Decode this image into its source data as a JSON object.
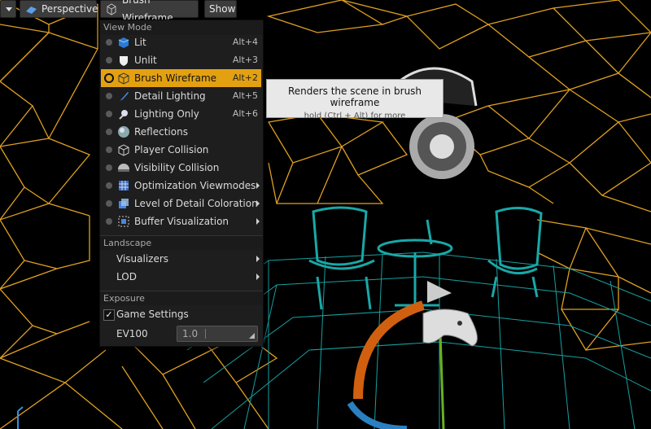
{
  "toolbar": {
    "perspective_label": "Perspective",
    "viewmode_label": "Brush Wireframe",
    "show_label": "Show"
  },
  "menu": {
    "section_viewmode": "View Mode",
    "items": [
      {
        "label": "Lit",
        "shortcut": "Alt+4",
        "icon": "lit-cube-icon"
      },
      {
        "label": "Unlit",
        "shortcut": "Alt+3",
        "icon": "shield-icon"
      },
      {
        "label": "Brush Wireframe",
        "shortcut": "Alt+2",
        "icon": "wireframe-cube-icon"
      },
      {
        "label": "Detail Lighting",
        "shortcut": "Alt+5",
        "icon": "brush-icon"
      },
      {
        "label": "Lighting Only",
        "shortcut": "Alt+6",
        "icon": "bulb-icon"
      },
      {
        "label": "Reflections",
        "icon": "sphere-icon"
      },
      {
        "label": "Player Collision",
        "icon": "outline-cube-icon"
      },
      {
        "label": "Visibility Collision",
        "icon": "half-sphere-icon"
      },
      {
        "label": "Optimization Viewmodes",
        "icon": "grid-icon"
      },
      {
        "label": "Level of Detail Coloration",
        "icon": "stacked-squares-icon"
      },
      {
        "label": "Buffer Visualization",
        "icon": "dotted-square-icon"
      }
    ],
    "section_landscape": "Landscape",
    "landscape_items": [
      {
        "label": "Visualizers"
      },
      {
        "label": "LOD"
      }
    ],
    "section_exposure": "Exposure",
    "game_settings_label": "Game Settings",
    "game_settings_checked": true,
    "ev100_label": "EV100",
    "ev100_value": "1.0"
  },
  "tooltip": {
    "title": "Renders the scene in brush wireframe",
    "hint": "hold (Ctrl + Alt) for more"
  },
  "colors": {
    "accent": "#e3a112",
    "wire_orange": "#e0a020",
    "wire_teal": "#1aa3a3"
  }
}
